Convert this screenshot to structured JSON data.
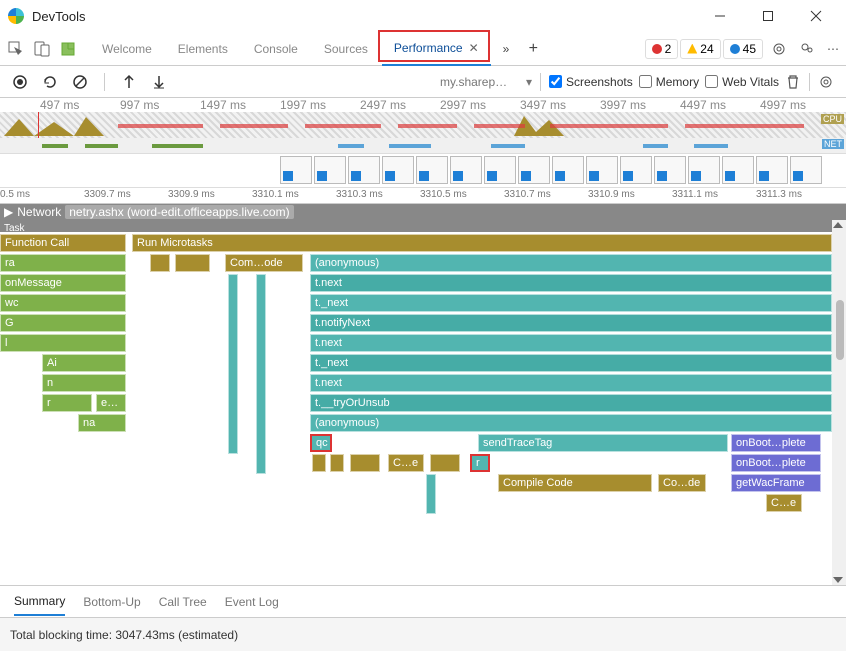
{
  "window": {
    "title": "DevTools"
  },
  "tabs": {
    "items": [
      "Welcome",
      "Elements",
      "Console",
      "Sources",
      "Performance"
    ],
    "active_index": 4
  },
  "badges": {
    "errors": "2",
    "warnings": "24",
    "messages": "45"
  },
  "toolbar": {
    "filter_text": "my.sharep…",
    "screenshots_label": "Screenshots",
    "memory_label": "Memory",
    "webvitals_label": "Web Vitals",
    "screenshots_checked": true,
    "memory_checked": false,
    "webvitals_checked": false
  },
  "overview_ticks": [
    "497 ms",
    "997 ms",
    "1497 ms",
    "1997 ms",
    "2497 ms",
    "2997 ms",
    "3497 ms",
    "3997 ms",
    "4497 ms",
    "4997 ms"
  ],
  "side_labels": {
    "cpu": "CPU",
    "net": "NET"
  },
  "detail_ticks": [
    "0.5 ms",
    "3309.7 ms",
    "3309.9 ms",
    "3310.1 ms",
    "3310.3 ms",
    "3310.5 ms",
    "3310.7 ms",
    "3310.9 ms",
    "3311.1 ms",
    "3311.3 ms"
  ],
  "network_lane": {
    "label": "Network",
    "item": "netry.ashx (word-edit.officeapps.live.com)"
  },
  "flame": {
    "task": "Task",
    "func_call": "Function Call",
    "run_microtasks": "Run Microtasks",
    "com_ode": "Com…ode",
    "left": {
      "ra": "ra",
      "onMessage": "onMessage",
      "wc": "wc",
      "G": "G",
      "l": "l",
      "Ai": "Ai",
      "n": "n",
      "r": "r",
      "e": "e…",
      "na": "na"
    },
    "teal": {
      "anonymous": "(anonymous)",
      "tnext1": "t.next",
      "t_next1": "t._next",
      "tnotify": "t.notifyNext",
      "tnext2": "t.next",
      "t_next2": "t._next",
      "tnext3": "t.next",
      "ttry": "t.__tryOrUnsub",
      "anonymous2": "(anonymous)",
      "qc": "qc",
      "sendTraceTag": "sendTraceTag",
      "r": "r"
    },
    "olive2": {
      "ce": "C…e",
      "compile": "Compile Code",
      "code": "Co…de",
      "ce2": "C…e"
    },
    "purple": {
      "onBoot1": "onBoot…plete",
      "onBoot2": "onBoot…plete",
      "getWac": "getWacFrame"
    }
  },
  "bottom_tabs": [
    "Summary",
    "Bottom-Up",
    "Call Tree",
    "Event Log"
  ],
  "status": {
    "text": "Total blocking time: 3047.43ms (estimated)"
  }
}
